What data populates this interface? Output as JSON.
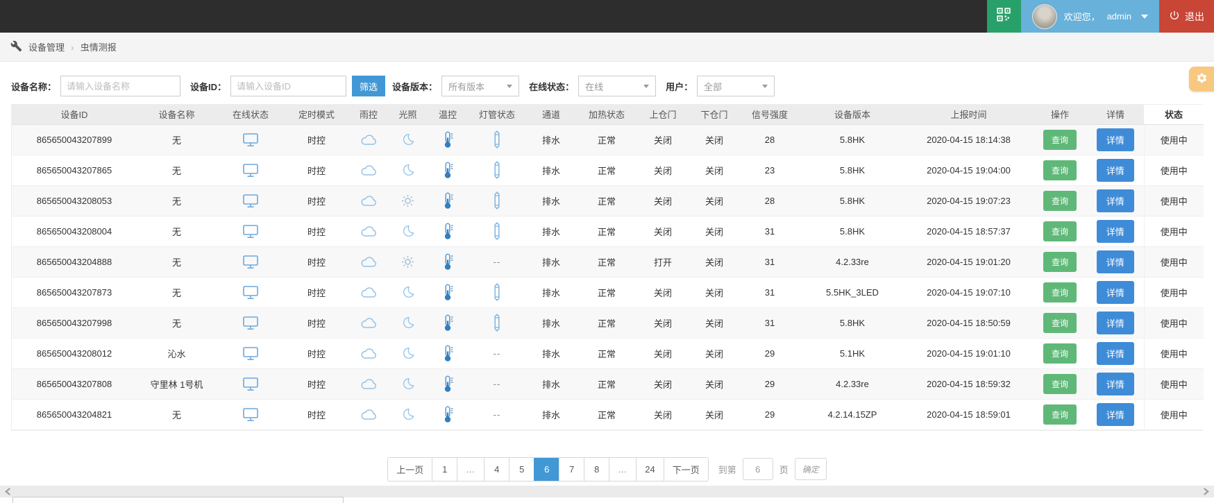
{
  "topbar": {
    "qr_button": "qr-code",
    "welcome": "欢迎您，",
    "username": "admin",
    "logout_label": "退出"
  },
  "breadcrumb": {
    "items": [
      "设备管理",
      "虫情测报"
    ],
    "separator": "›"
  },
  "filters": {
    "name_label": "设备名称：",
    "name_placeholder": "请输入设备名称",
    "id_label": "设备ID：",
    "id_placeholder": "请输入设备ID",
    "filter_button": "筛选",
    "version_label": "设备版本：",
    "version_value": "所有版本",
    "online_label": "在线状态：",
    "online_value": "在线",
    "user_label": "用户：",
    "user_value": "全部"
  },
  "colors": {
    "accent_blue": "#4298d5",
    "detail_blue": "#3e8cd8",
    "query_green": "#5fb878",
    "topbar_green": "#27a169",
    "topbar_blue": "#67b1da",
    "topbar_red": "#c94536",
    "gear_orange": "#f8c880",
    "icon_blue": "#6aa7dc"
  },
  "table": {
    "columns": [
      "设备ID",
      "设备名称",
      "在线状态",
      "定时模式",
      "雨控",
      "光照",
      "温控",
      "灯管状态",
      "通道",
      "加热状态",
      "上仓门",
      "下仓门",
      "信号强度",
      "设备版本",
      "上报时间",
      "操作",
      "详情",
      "状态"
    ],
    "query_label": "查询",
    "detail_label": "详情",
    "rows": [
      {
        "device_id": "865650043207899",
        "device_name": "无",
        "online_icon": "monitor",
        "timer_mode": "时控",
        "rain_icon": "cloud",
        "light_icon": "moon",
        "temp_icon": "thermometer",
        "lamp_icon": "tube",
        "channel": "排水",
        "heating": "正常",
        "upper_door": "关闭",
        "lower_door": "关闭",
        "signal": "28",
        "version": "5.8HK",
        "report_time": "2020-04-15 18:14:38",
        "status": "使用中"
      },
      {
        "device_id": "865650043207865",
        "device_name": "无",
        "online_icon": "monitor",
        "timer_mode": "时控",
        "rain_icon": "cloud",
        "light_icon": "moon",
        "temp_icon": "thermometer",
        "lamp_icon": "tube",
        "channel": "排水",
        "heating": "正常",
        "upper_door": "关闭",
        "lower_door": "关闭",
        "signal": "23",
        "version": "5.8HK",
        "report_time": "2020-04-15 19:04:00",
        "status": "使用中"
      },
      {
        "device_id": "865650043208053",
        "device_name": "无",
        "online_icon": "monitor",
        "timer_mode": "时控",
        "rain_icon": "cloud",
        "light_icon": "sun",
        "temp_icon": "thermometer",
        "lamp_icon": "tube",
        "channel": "排水",
        "heating": "正常",
        "upper_door": "关闭",
        "lower_door": "关闭",
        "signal": "28",
        "version": "5.8HK",
        "report_time": "2020-04-15 19:07:23",
        "status": "使用中"
      },
      {
        "device_id": "865650043208004",
        "device_name": "无",
        "online_icon": "monitor",
        "timer_mode": "时控",
        "rain_icon": "cloud",
        "light_icon": "moon",
        "temp_icon": "thermometer",
        "lamp_icon": "tube",
        "channel": "排水",
        "heating": "正常",
        "upper_door": "关闭",
        "lower_door": "关闭",
        "signal": "31",
        "version": "5.8HK",
        "report_time": "2020-04-15 18:57:37",
        "status": "使用中"
      },
      {
        "device_id": "865650043204888",
        "device_name": "无",
        "online_icon": "monitor",
        "timer_mode": "时控",
        "rain_icon": "cloud",
        "light_icon": "sun",
        "temp_icon": "thermometer",
        "lamp_icon": "--",
        "channel": "排水",
        "heating": "正常",
        "upper_door": "打开",
        "lower_door": "关闭",
        "signal": "31",
        "version": "4.2.33re",
        "report_time": "2020-04-15 19:01:20",
        "status": "使用中"
      },
      {
        "device_id": "865650043207873",
        "device_name": "无",
        "online_icon": "monitor",
        "timer_mode": "时控",
        "rain_icon": "cloud",
        "light_icon": "moon",
        "temp_icon": "thermometer",
        "lamp_icon": "tube",
        "channel": "排水",
        "heating": "正常",
        "upper_door": "关闭",
        "lower_door": "关闭",
        "signal": "31",
        "version": "5.5HK_3LED",
        "report_time": "2020-04-15 19:07:10",
        "status": "使用中"
      },
      {
        "device_id": "865650043207998",
        "device_name": "无",
        "online_icon": "monitor",
        "timer_mode": "时控",
        "rain_icon": "cloud",
        "light_icon": "moon",
        "temp_icon": "thermometer",
        "lamp_icon": "tube",
        "channel": "排水",
        "heating": "正常",
        "upper_door": "关闭",
        "lower_door": "关闭",
        "signal": "31",
        "version": "5.8HK",
        "report_time": "2020-04-15 18:50:59",
        "status": "使用中"
      },
      {
        "device_id": "865650043208012",
        "device_name": "沁水",
        "online_icon": "monitor",
        "timer_mode": "时控",
        "rain_icon": "cloud",
        "light_icon": "moon",
        "temp_icon": "thermometer",
        "lamp_icon": "--",
        "channel": "排水",
        "heating": "正常",
        "upper_door": "关闭",
        "lower_door": "关闭",
        "signal": "29",
        "version": "5.1HK",
        "report_time": "2020-04-15 19:01:10",
        "status": "使用中"
      },
      {
        "device_id": "865650043207808",
        "device_name": "守里林 1号机",
        "online_icon": "monitor",
        "timer_mode": "时控",
        "rain_icon": "cloud",
        "light_icon": "moon",
        "temp_icon": "thermometer",
        "lamp_icon": "--",
        "channel": "排水",
        "heating": "正常",
        "upper_door": "关闭",
        "lower_door": "关闭",
        "signal": "29",
        "version": "4.2.33re",
        "report_time": "2020-04-15 18:59:32",
        "status": "使用中"
      },
      {
        "device_id": "865650043204821",
        "device_name": "无",
        "online_icon": "monitor",
        "timer_mode": "时控",
        "rain_icon": "cloud",
        "light_icon": "moon",
        "temp_icon": "thermometer",
        "lamp_icon": "--",
        "channel": "排水",
        "heating": "正常",
        "upper_door": "关闭",
        "lower_door": "关闭",
        "signal": "29",
        "version": "4.2.14.15ZP",
        "report_time": "2020-04-15 18:59:01",
        "status": "使用中"
      }
    ]
  },
  "pagination": {
    "items": [
      {
        "label": "上一页",
        "kind": "prev"
      },
      {
        "label": "1",
        "kind": "page"
      },
      {
        "label": "…",
        "kind": "ellipsis"
      },
      {
        "label": "4",
        "kind": "page"
      },
      {
        "label": "5",
        "kind": "page"
      },
      {
        "label": "6",
        "kind": "page",
        "active": true
      },
      {
        "label": "7",
        "kind": "page"
      },
      {
        "label": "8",
        "kind": "page"
      },
      {
        "label": "…",
        "kind": "ellipsis"
      },
      {
        "label": "24",
        "kind": "page"
      },
      {
        "label": "下一页",
        "kind": "next"
      }
    ],
    "goto_label": "到第",
    "goto_value": "6",
    "goto_suffix": "页",
    "confirm_label": "确定"
  }
}
